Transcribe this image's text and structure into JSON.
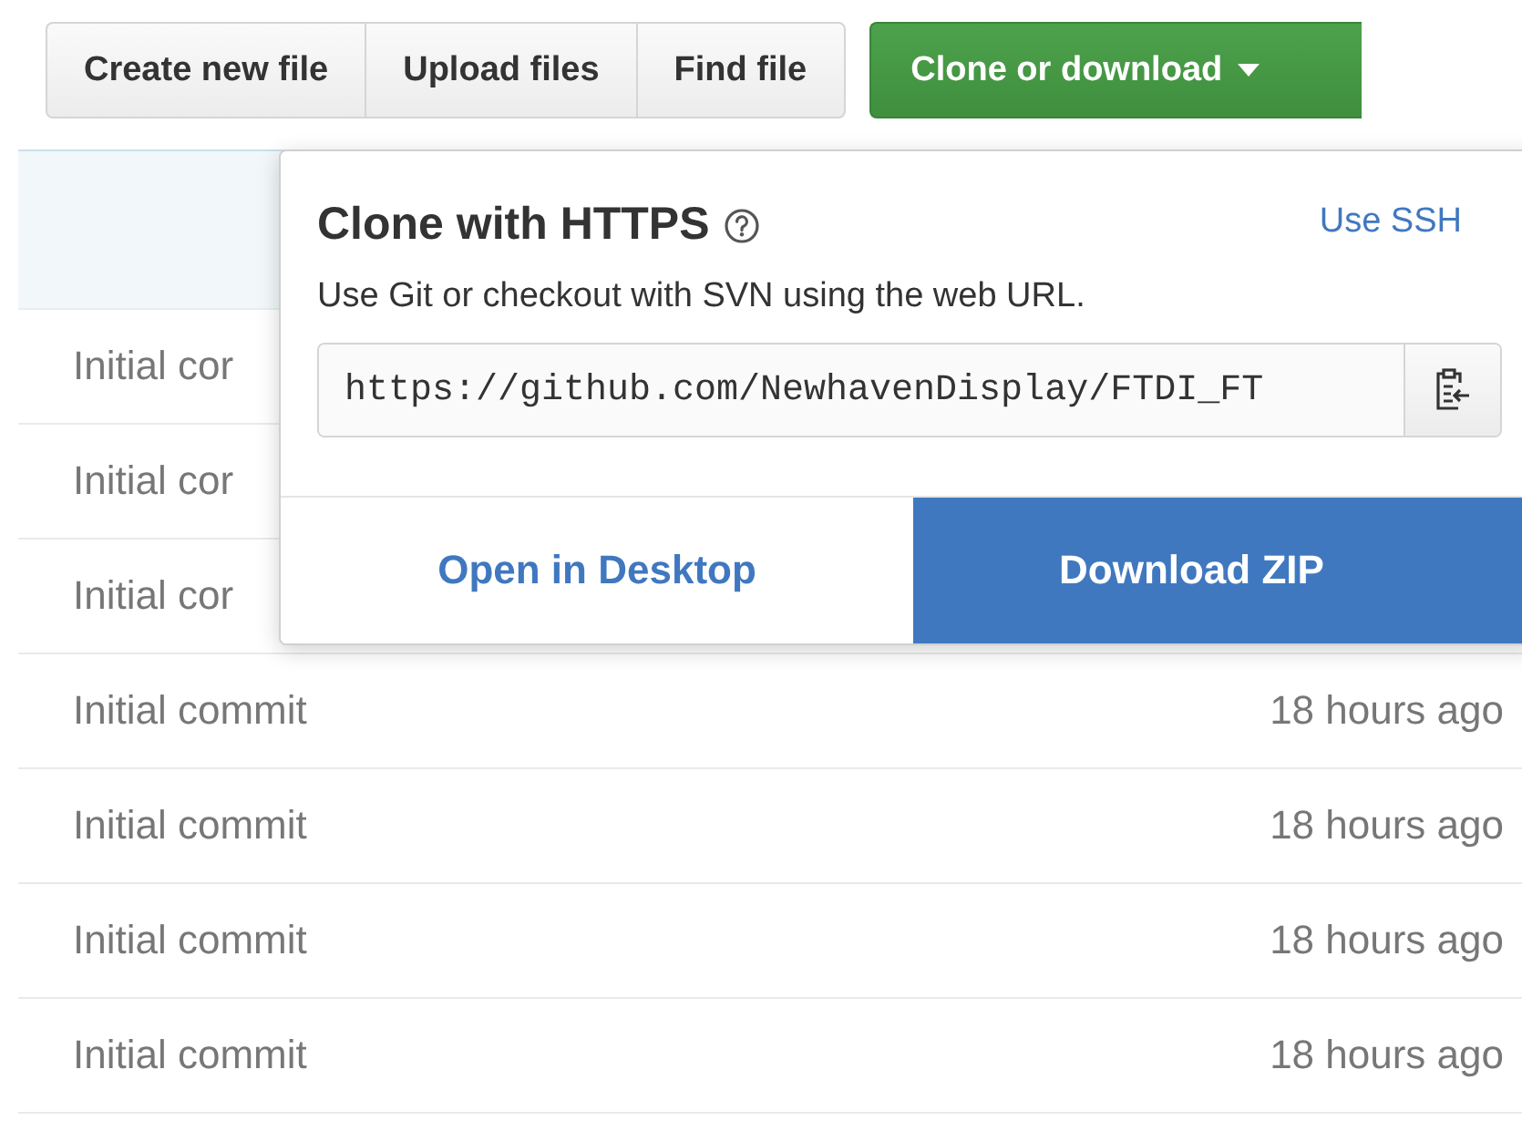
{
  "toolbar": {
    "buttons": [
      {
        "label": "Create new file",
        "kind": "default"
      },
      {
        "label": "Upload files",
        "kind": "default"
      },
      {
        "label": "Find file",
        "kind": "default"
      },
      {
        "label": "Clone or download",
        "kind": "primary",
        "expanded": true
      }
    ]
  },
  "file_list": {
    "rows": [
      {
        "message": "Initial cor"
      },
      {
        "message": "Initial cor"
      },
      {
        "message": "Initial cor"
      },
      {
        "message": "Initial commit",
        "time": "18 hours ago"
      },
      {
        "message": "Initial commit",
        "time": "18 hours ago"
      },
      {
        "message": "Initial commit",
        "time": "18 hours ago"
      },
      {
        "message": "Initial commit",
        "time": "18 hours ago"
      }
    ]
  },
  "clone_popup": {
    "title": "Clone with HTTPS",
    "switch_link": "Use SSH",
    "description": "Use Git or checkout with SVN using the web URL.",
    "url": "https://github.com/NewhavenDisplay/FTDI_FT",
    "actions": [
      {
        "label": "Open in Desktop",
        "kind": "link"
      },
      {
        "label": "Download ZIP",
        "kind": "primary"
      }
    ]
  }
}
